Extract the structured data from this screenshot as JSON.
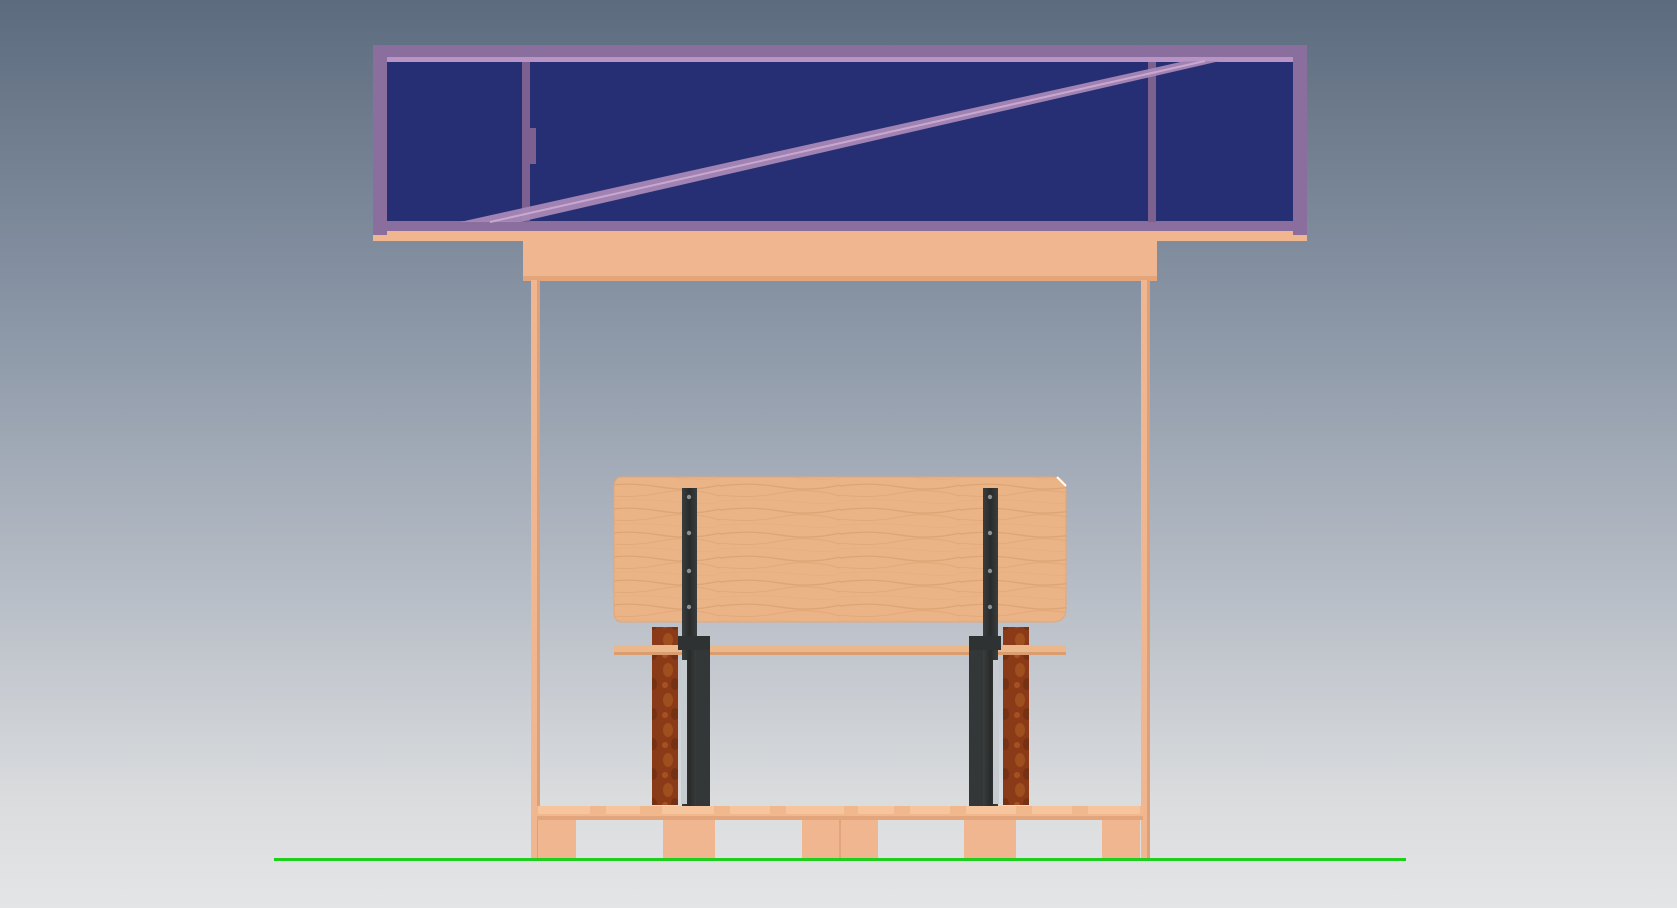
{
  "scene": {
    "subject": "bus-shelter-with-bench",
    "view": "front",
    "colors": {
      "background_top": "#5c6b7e",
      "background_bottom": "#e4e5e6",
      "roof_frame": "#8a6f9e",
      "roof_frame_light": "#a98bb8",
      "roof_glass": "#262f73",
      "roof_brace": "#b78fbf",
      "wood_light": "#f4c29a",
      "wood_mid": "#e6ad80",
      "wood_grain": "#d9a06e",
      "bench_dark_wood": "#8a3a17",
      "steel_bracket": "#2f3232",
      "ground_line": "#1ecf1e"
    },
    "icons": [
      "ground-line",
      "roof-canopy",
      "bench",
      "pallet-base"
    ]
  }
}
